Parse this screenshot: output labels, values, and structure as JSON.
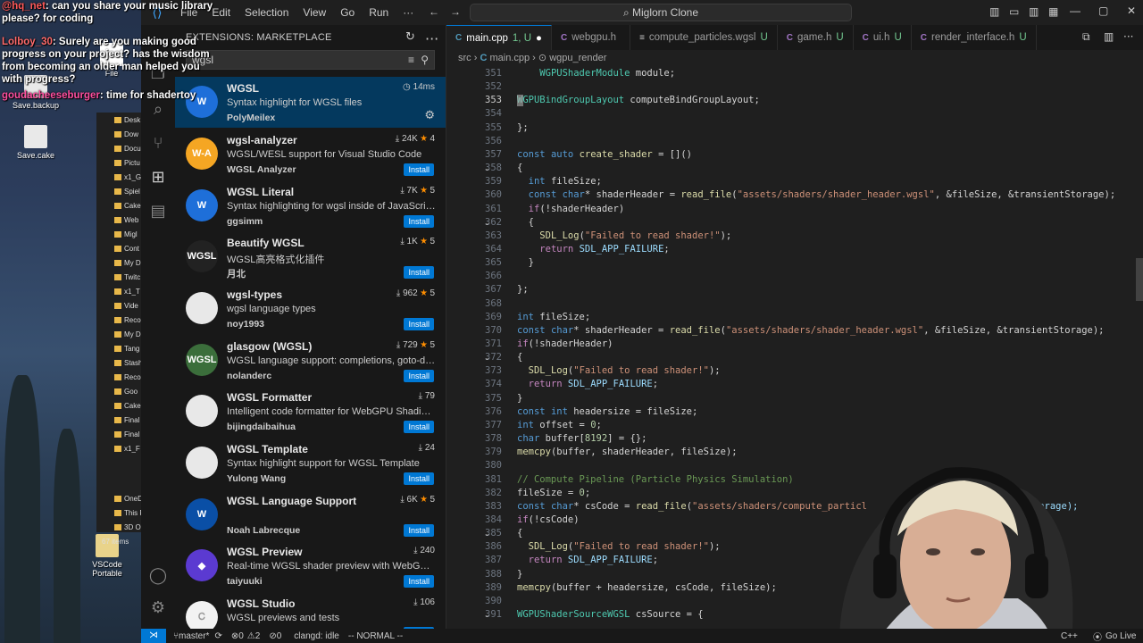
{
  "stream": {
    "chat": [
      {
        "name": "@hq_net",
        "text": ": can you share your music library please? for coding"
      },
      {
        "name": "Lolboy_30",
        "text": ": Surely are you making good progress on your project? has the wisdom from becoming an older man helped you with progress?"
      },
      {
        "name": "goudacheeseburger",
        "text": ": time for shadertoy"
      }
    ],
    "desktop_icons": [
      "File",
      "Save.backup",
      "Save.cake",
      "VSCode Portable"
    ],
    "explorer_items": [
      "Desk",
      "Dow",
      "Docu",
      "Pictu",
      "x1_G",
      "Spiel",
      "Cake",
      "Web",
      "Migl",
      "Cont",
      "My D",
      "Twitc",
      "x1_T",
      "Vide",
      "Reco",
      "My D",
      "Tang",
      "Stash",
      "Reco",
      "Goo",
      "Cake",
      "Final",
      "Final",
      "x1_F",
      "OneDr",
      "This P",
      "3D O"
    ],
    "explorer_count": "67 items"
  },
  "titlebar": {
    "menus": [
      "File",
      "Edit",
      "Selection",
      "View",
      "Go",
      "Run",
      "···"
    ],
    "command_center": "Miglorn Clone"
  },
  "sidebar": {
    "header": "EXTENSIONS: MARKETPLACE",
    "search": "wgsl",
    "install_label": "Install",
    "extensions": [
      {
        "name": "WGSL",
        "desc": "Syntax highlight for WGSL files",
        "publisher": "PolyMeilex",
        "stat": "14ms",
        "rating": "",
        "logo": "W",
        "logo_bg": "#1e6fd9",
        "installed": true
      },
      {
        "name": "wgsl-analyzer",
        "desc": "WGSL/WESL support for Visual Studio Code",
        "publisher": "WGSL Analyzer",
        "stat": "24K",
        "rating": "4",
        "logo": "W-A",
        "logo_bg": "#f5a623",
        "installed": false
      },
      {
        "name": "WGSL Literal",
        "desc": "Syntax highlighting for wgsl inside of JavaScript ta...",
        "publisher": "ggsimm",
        "stat": "7K",
        "rating": "5",
        "logo": "W",
        "logo_bg": "#1e6fd9",
        "installed": false
      },
      {
        "name": "Beautify WGSL",
        "desc": "WGSL高亮格式化插件",
        "publisher": "月北",
        "stat": "1K",
        "rating": "5",
        "logo": "WGSL",
        "logo_bg": "#222222",
        "installed": false
      },
      {
        "name": "wgsl-types",
        "desc": "wgsl language types",
        "publisher": "noy1993",
        "stat": "962",
        "rating": "5",
        "logo": "",
        "logo_bg": "#e8e8e8",
        "installed": false
      },
      {
        "name": "glasgow (WGSL)",
        "desc": "WGSL language support: completions, goto-defin...",
        "publisher": "nolanderc",
        "stat": "729",
        "rating": "5",
        "logo": "WGSL",
        "logo_bg": "#3b6e3b",
        "installed": false
      },
      {
        "name": "WGSL Formatter",
        "desc": "Intelligent code formatter for WebGPU Shading L...",
        "publisher": "bijingdaibaihua",
        "stat": "79",
        "rating": "",
        "logo": "",
        "logo_bg": "#e8e8e8",
        "installed": false
      },
      {
        "name": "WGSL Template",
        "desc": "Syntax highlight support for WGSL Template",
        "publisher": "Yulong Wang",
        "stat": "24",
        "rating": "",
        "logo": "",
        "logo_bg": "#e8e8e8",
        "installed": false
      },
      {
        "name": "WGSL Language Support",
        "desc": "",
        "publisher": "Noah Labrecque",
        "stat": "6K",
        "rating": "5",
        "logo": "W",
        "logo_bg": "#0a4fa6",
        "installed": false
      },
      {
        "name": "WGSL Preview",
        "desc": "Real-time WGSL shader preview with WebGPU re...",
        "publisher": "taiyuuki",
        "stat": "240",
        "rating": "",
        "logo": "◆",
        "logo_bg": "#5b3ad1",
        "installed": false
      },
      {
        "name": "WGSL Studio",
        "desc": "WGSL previews and tests",
        "publisher": "",
        "stat": "106",
        "rating": "",
        "logo": "Ꮯ",
        "logo_bg": "#f2f2f2",
        "installed": false
      }
    ]
  },
  "tabs": [
    {
      "label": "main.cpp",
      "badge": "1, U",
      "icon": "C",
      "icon_color": "#519aba",
      "active": true
    },
    {
      "label": "webgpu.h",
      "badge": "",
      "icon": "C",
      "icon_color": "#a074c4",
      "active": false
    },
    {
      "label": "compute_particles.wgsl",
      "badge": "U",
      "icon": "≡",
      "icon_color": "#ccc",
      "active": false
    },
    {
      "label": "game.h",
      "badge": "U",
      "icon": "C",
      "icon_color": "#a074c4",
      "active": false
    },
    {
      "label": "ui.h",
      "badge": "U",
      "icon": "C",
      "icon_color": "#a074c4",
      "active": false
    },
    {
      "label": "render_interface.h",
      "badge": "U",
      "icon": "C",
      "icon_color": "#a074c4",
      "active": false
    }
  ],
  "breadcrumb": [
    "src",
    "main.cpp",
    "wgpu_render"
  ],
  "code_lines": [
    {
      "n": "351",
      "t": "    WGPUShaderModule module;"
    },
    {
      "n": "352",
      "t": ""
    },
    {
      "n": "353",
      "t": "WGPUBindGroupLayout computeBindGroupLayout;"
    },
    {
      "n": "354",
      "t": ""
    },
    {
      "n": "355",
      "t": "};"
    },
    {
      "n": "356",
      "t": ""
    },
    {
      "n": "357",
      "t": "const auto create_shader = []()"
    },
    {
      "n": "358",
      "t": "{"
    },
    {
      "n": "359",
      "t": "  int fileSize;"
    },
    {
      "n": "360",
      "t": "  const char* shaderHeader = read_file(\"assets/shaders/shader_header.wgsl\", &fileSize, &transientStorage);"
    },
    {
      "n": "361",
      "t": "  if(!shaderHeader)"
    },
    {
      "n": "362",
      "t": "  {"
    },
    {
      "n": "363",
      "t": "    SDL_Log(\"Failed to read shader!\");"
    },
    {
      "n": "364",
      "t": "    return SDL_APP_FAILURE;"
    },
    {
      "n": "365",
      "t": "  }"
    },
    {
      "n": "366",
      "t": ""
    },
    {
      "n": "367",
      "t": "};"
    },
    {
      "n": "368",
      "t": ""
    },
    {
      "n": "369",
      "t": "int fileSize;"
    },
    {
      "n": "370",
      "t": "const char* shaderHeader = read_file(\"assets/shaders/shader_header.wgsl\", &fileSize, &transientStorage);"
    },
    {
      "n": "371",
      "t": "if(!shaderHeader)"
    },
    {
      "n": "372",
      "t": "{"
    },
    {
      "n": "373",
      "t": "  SDL_Log(\"Failed to read shader!\");"
    },
    {
      "n": "374",
      "t": "  return SDL_APP_FAILURE;"
    },
    {
      "n": "375",
      "t": "}"
    },
    {
      "n": "376",
      "t": "const int headersize = fileSize;"
    },
    {
      "n": "377",
      "t": "int offset = 0;"
    },
    {
      "n": "378",
      "t": "char buffer[8192] = {};"
    },
    {
      "n": "379",
      "t": "memcpy(buffer, shaderHeader, fileSize);"
    },
    {
      "n": "380",
      "t": ""
    },
    {
      "n": "381",
      "t": "// Compute Pipeline (Particle Physics Simulation)"
    },
    {
      "n": "382",
      "t": "fileSize = 0;"
    },
    {
      "n": "383",
      "t": "const char* csCode = read_file(\"assets/shaders/compute_particl"
    },
    {
      "n": "384",
      "t": "if(!csCode)"
    },
    {
      "n": "385",
      "t": "{"
    },
    {
      "n": "386",
      "t": "  SDL_Log(\"Failed to read shader!\");"
    },
    {
      "n": "387",
      "t": "  return SDL_APP_FAILURE;"
    },
    {
      "n": "388",
      "t": "}"
    },
    {
      "n": "389",
      "t": "memcpy(buffer + headersize, csCode, fileSize);"
    },
    {
      "n": "390",
      "t": ""
    },
    {
      "n": "391",
      "t": "WGPUShaderSourceWGSL csSource = {"
    }
  ],
  "code_line_383_tail": "ransientStorage);",
  "status": {
    "branch": "master*",
    "errors": "0",
    "warnings": "2",
    "info": "0",
    "clangd": "clangd: idle",
    "mode": "-- NORMAL --",
    "lang": "C++",
    "golive": "Go Live"
  },
  "colors": {
    "accent": "#0078d4",
    "selected_row": "#04395e",
    "install": "#0078d4"
  }
}
